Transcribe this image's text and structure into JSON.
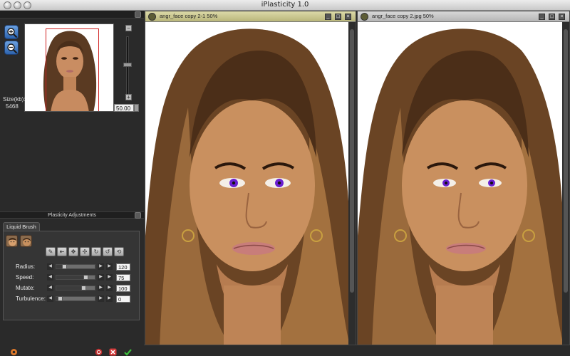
{
  "app": {
    "title": "iPlasticity 1.0"
  },
  "navigator": {
    "size_label": "Size(kb):",
    "size_value": "5468",
    "zoom_value": "50.00"
  },
  "plasticity": {
    "title": "Plasticity Adjustments",
    "tab_label": "Liquid Brush",
    "params": [
      {
        "label": "Radius:",
        "value": "120",
        "fraction": 0.2
      },
      {
        "label": "Speed:",
        "value": "75",
        "fraction": 0.75
      },
      {
        "label": "Mutate:",
        "value": "100",
        "fraction": 0.7
      },
      {
        "label": "Turbulence:",
        "value": "0",
        "fraction": 0.1
      }
    ]
  },
  "windows": [
    {
      "caption": "angr_face copy 2-1 50%",
      "active": true
    },
    {
      "caption": "angr_face copy 2.jpg 50%",
      "active": false
    }
  ],
  "colors": {
    "panel": "#2a2a2a",
    "active_title": "#c9c68d",
    "accent_blue": "#3b73c0",
    "eye_purple": "#6a1fd1",
    "cancel_red": "#d23a3a",
    "ok_green": "#3bbf3b"
  },
  "icons": {
    "zoom_in": "magnifier-plus-icon",
    "zoom_out": "magnifier-minus-icon",
    "tools": [
      "brush-icon",
      "push-left-icon",
      "expand-icon",
      "contract-icon",
      "twirl-cw-icon",
      "twirl-ccw-icon",
      "restore-icon"
    ]
  }
}
